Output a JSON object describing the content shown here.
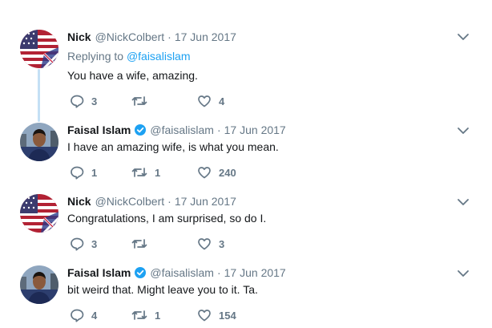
{
  "tweets": [
    {
      "name": "Nick",
      "handle": "@NickColbert",
      "separator": "·",
      "date": "17 Jun 2017",
      "verified": false,
      "replying_prefix": "Replying to",
      "replying_to": "@faisalislam",
      "text": "You have a wife, amazing.",
      "replies": "3",
      "retweets": "",
      "likes": "4"
    },
    {
      "name": "Faisal Islam",
      "handle": "@faisalislam",
      "separator": "·",
      "date": "17 Jun 2017",
      "verified": true,
      "text": "I have an amazing wife, is what you mean.",
      "replies": "1",
      "retweets": "1",
      "likes": "240"
    },
    {
      "name": "Nick",
      "handle": "@NickColbert",
      "separator": "·",
      "date": "17 Jun 2017",
      "verified": false,
      "text": "Congratulations, I am surprised, so do I.",
      "replies": "3",
      "retweets": "",
      "likes": "3"
    },
    {
      "name": "Faisal Islam",
      "handle": "@faisalislam",
      "separator": "·",
      "date": "17 Jun 2017",
      "verified": true,
      "text": "bit weird that. Might leave you to it. Ta.",
      "replies": "4",
      "retweets": "1",
      "likes": "154"
    }
  ],
  "icons": {
    "reply": "reply-icon",
    "retweet": "retweet-icon",
    "like": "heart-icon",
    "menu": "chevron-down-icon",
    "verified": "verified-badge-icon"
  },
  "colors": {
    "accent": "#1da1f2",
    "muted": "#657786",
    "text": "#14171a",
    "thread_line": "#c4e0f5"
  }
}
